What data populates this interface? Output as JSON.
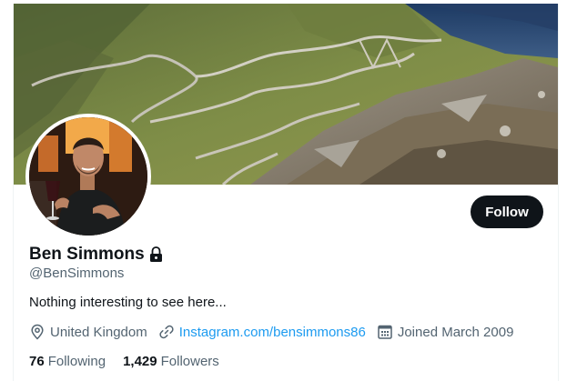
{
  "profile": {
    "display_name": "Ben Simmons",
    "handle": "@BenSimmons",
    "bio": "Nothing interesting to see here...",
    "location": "United Kingdom",
    "website": "Instagram.com/bensimmons86",
    "joined": "Joined March 2009",
    "protected_icon": "lock-icon"
  },
  "actions": {
    "follow_label": "Follow"
  },
  "stats": {
    "following_count": "76",
    "following_label": "Following",
    "followers_count": "1,429",
    "followers_label": "Followers"
  },
  "icons": {
    "location": "location-pin-icon",
    "website": "link-icon",
    "joined": "calendar-icon"
  },
  "colors": {
    "accent_link": "#1d9bf0",
    "button_bg": "#0f1419",
    "secondary_text": "#536471"
  }
}
